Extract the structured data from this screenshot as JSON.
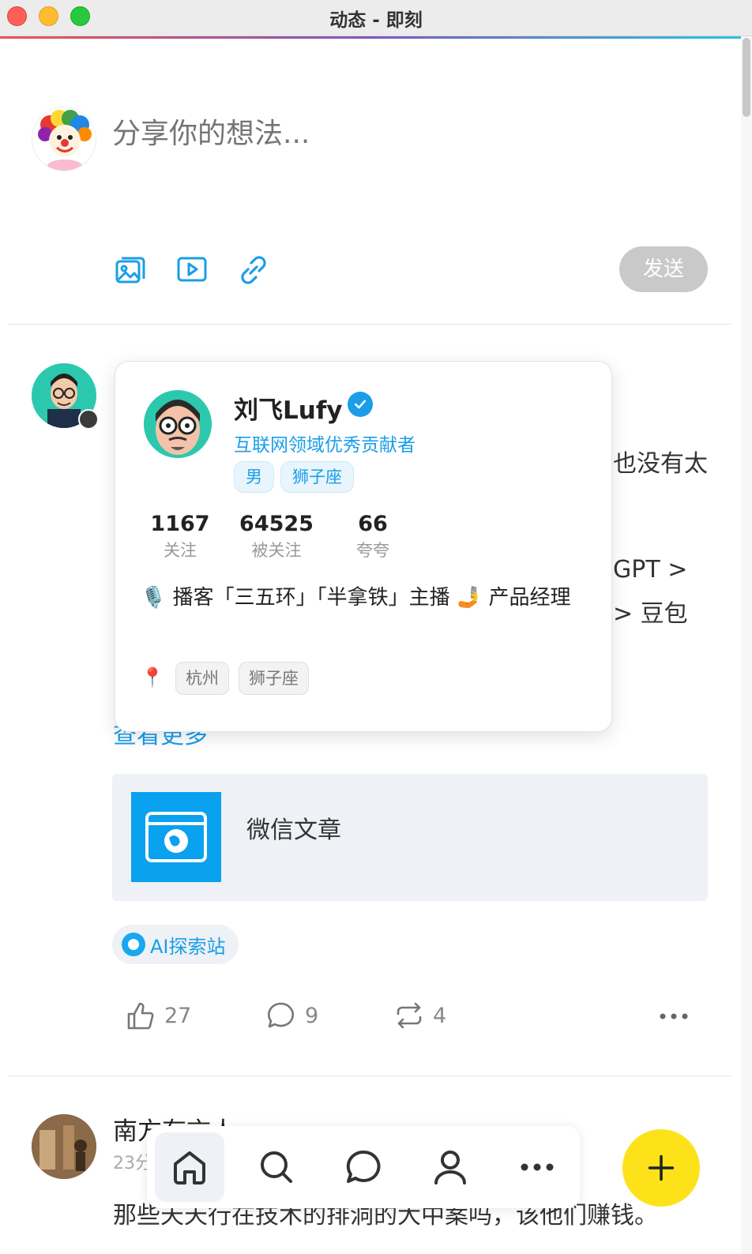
{
  "window": {
    "title": "动态 - 即刻"
  },
  "composer": {
    "placeholder": "分享你的想法...",
    "send_label": "发送"
  },
  "post": {
    "partial_lines": [
      "也没有太",
      "GPT >",
      "> 豆包"
    ],
    "more_label": "查看更多",
    "link_card": {
      "title": "微信文章"
    },
    "topic": "AI探索站",
    "likes": "27",
    "comments": "9",
    "reposts": "4"
  },
  "post2": {
    "author": "南方有言人",
    "time": "23分",
    "body": "那些天天行在技术的排洞的大中案吗，该他们赚钱。"
  },
  "profile_card": {
    "name": "刘飞Lufy",
    "title": "互联网领域优秀贡献者",
    "tags": [
      "男",
      "狮子座"
    ],
    "stats": [
      {
        "value": "1167",
        "label": "关注"
      },
      {
        "value": "64525",
        "label": "被关注"
      },
      {
        "value": "66",
        "label": "夸夸"
      }
    ],
    "bio": "🎙️ 播客「三五环」「半拿铁」主播 🤳 产品经理",
    "location_tags": [
      "杭州",
      "狮子座"
    ],
    "pin_icon": "📍"
  },
  "colors": {
    "accent": "#1a9ee8",
    "fab": "#fde21a",
    "send_disabled": "#c9c9c9"
  }
}
